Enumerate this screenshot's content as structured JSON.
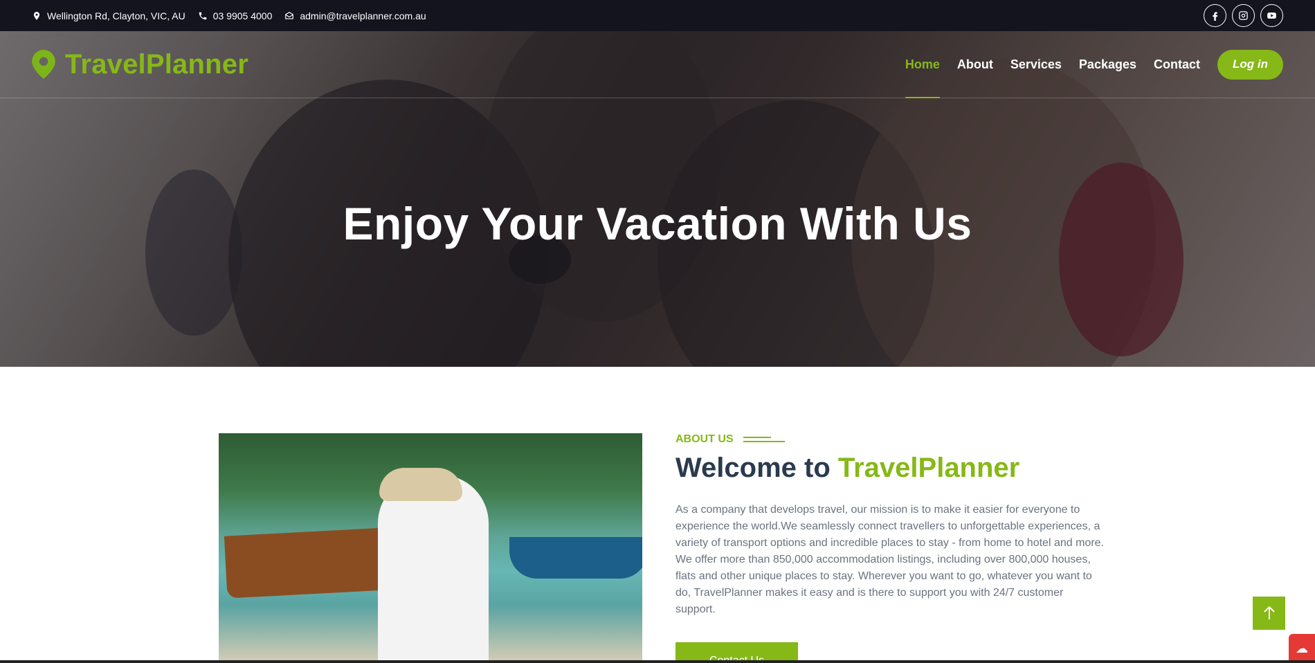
{
  "topbar": {
    "address": "Wellington Rd, Clayton, VIC, AU",
    "phone": "03 9905 4000",
    "email": "admin@travelplanner.com.au",
    "social": [
      "facebook-icon",
      "instagram-icon",
      "youtube-icon"
    ]
  },
  "brand": {
    "name": "TravelPlanner",
    "icon": "map-pin-icon"
  },
  "nav": {
    "items": [
      {
        "label": "Home",
        "active": true
      },
      {
        "label": "About",
        "active": false
      },
      {
        "label": "Services",
        "active": false
      },
      {
        "label": "Packages",
        "active": false
      },
      {
        "label": "Contact",
        "active": false
      }
    ],
    "login_label": "Log in"
  },
  "hero": {
    "title": "Enjoy Your Vacation With Us"
  },
  "about": {
    "tag": "ABOUT US",
    "heading_prefix": "Welcome to",
    "heading_accent": "TravelPlanner",
    "paragraph": "As a company that develops travel, our mission is to make it easier for everyone to experience the world.We seamlessly connect travellers to unforgettable experiences, a variety of transport options and incredible places to stay - from home to hotel and more. We offer more than 850,000 accommodation listings, including over 800,000 houses, flats and other unique places to stay. Wherever you want to go, whatever you want to do, TravelPlanner makes it easy and is there to support you with 24/7 customer support.",
    "button_label": "Contact Us"
  },
  "colors": {
    "accent": "#86b817",
    "topbar": "#14141f",
    "heading": "#2b3a4e"
  }
}
